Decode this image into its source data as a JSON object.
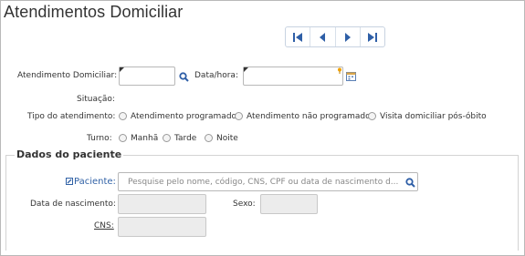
{
  "page": {
    "title": "Atendimentos Domiciliar"
  },
  "nav": {
    "buttons": [
      {
        "name": "first-record-button",
        "icon": "first-icon"
      },
      {
        "name": "previous-record-button",
        "icon": "previous-icon"
      },
      {
        "name": "next-record-button",
        "icon": "next-icon"
      },
      {
        "name": "last-record-button",
        "icon": "last-icon"
      }
    ]
  },
  "form": {
    "atendimento_label": "Atendimento Domiciliar:",
    "atendimento_value": "",
    "datahora_label": "Data/hora:",
    "datahora_value": "",
    "situacao_label": "Situação:",
    "situacao_value": "",
    "tipo_label": "Tipo do atendimento:",
    "tipo_options": [
      "Atendimento programado",
      "Atendimento não programado",
      "Visita domiciliar pós-óbito"
    ],
    "turno_label": "Turno:",
    "turno_options": [
      "Manhã",
      "Tarde",
      "Noite"
    ]
  },
  "paciente_section": {
    "title": "Dados do paciente",
    "paciente_label": "Paciente:",
    "paciente_placeholder": "Pesquise pelo nome, código, CNS, CPF ou data de nascimento d...",
    "nascimento_label": "Data de nascimento:",
    "sexo_label": "Sexo:",
    "cns_label": "CNS:"
  },
  "colors": {
    "accent": "#3162a6",
    "nav_icon": "#2f5fa7",
    "disabled_bg": "#ececec"
  }
}
